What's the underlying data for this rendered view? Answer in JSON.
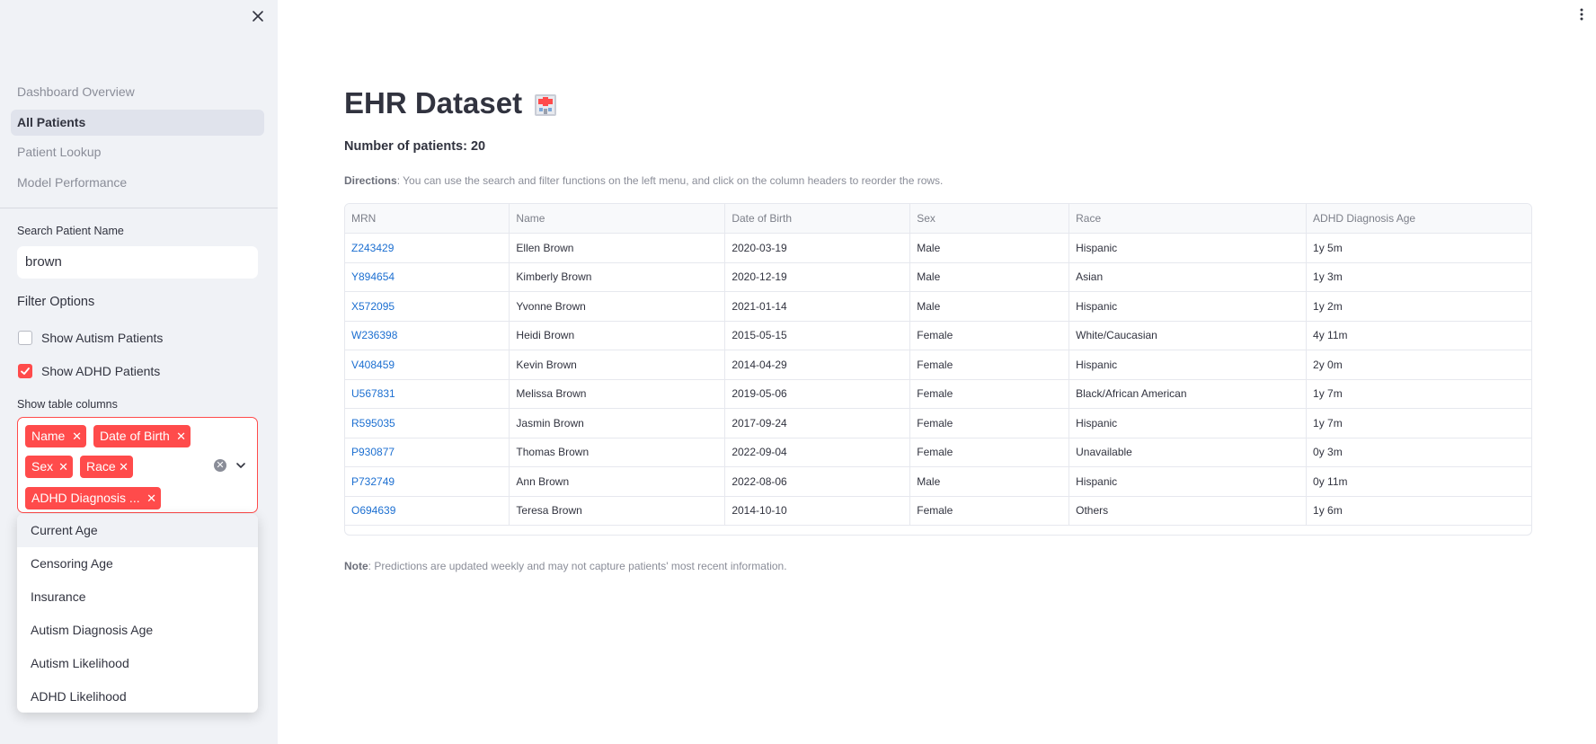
{
  "sidebar": {
    "nav": [
      {
        "label": "Dashboard Overview",
        "active": false
      },
      {
        "label": "All Patients",
        "active": true
      },
      {
        "label": "Patient Lookup",
        "active": false
      },
      {
        "label": "Model Performance",
        "active": false
      }
    ],
    "search_label": "Search Patient Name",
    "search_value": "brown",
    "filter_title": "Filter Options",
    "show_autism": {
      "label": "Show Autism Patients",
      "checked": false
    },
    "show_adhd": {
      "label": "Show ADHD Patients",
      "checked": true
    },
    "columns_label": "Show table columns",
    "selected_columns": [
      "Name",
      "Date of Birth",
      "Sex",
      "Race",
      "ADHD Diagnosis ..."
    ],
    "dropdown_options": [
      "Current Age",
      "Censoring Age",
      "Insurance",
      "Autism Diagnosis Age",
      "Autism Likelihood",
      "ADHD Likelihood"
    ]
  },
  "main": {
    "title": "EHR Dataset",
    "title_icon": "hospital-icon",
    "count_label": "Number of patients: 20",
    "directions_label": "Directions",
    "directions_text": ": You can use the search and filter functions on the left menu, and click on the column headers to reorder the rows.",
    "note_label": "Note",
    "note_text": ": Predictions are updated weekly and may not capture patients' most recent information."
  },
  "table": {
    "headers": [
      "MRN",
      "Name",
      "Date of Birth",
      "Sex",
      "Race",
      "ADHD Diagnosis Age"
    ],
    "rows": [
      [
        "Z243429",
        "Ellen Brown",
        "2020-03-19",
        "Male",
        "Hispanic",
        "1y 5m"
      ],
      [
        "Y894654",
        "Kimberly Brown",
        "2020-12-19",
        "Male",
        "Asian",
        "1y 3m"
      ],
      [
        "X572095",
        "Yvonne Brown",
        "2021-01-14",
        "Male",
        "Hispanic",
        "1y 2m"
      ],
      [
        "W236398",
        "Heidi Brown",
        "2015-05-15",
        "Female",
        "White/Caucasian",
        "4y 11m"
      ],
      [
        "V408459",
        "Kevin Brown",
        "2014-04-29",
        "Female",
        "Hispanic",
        "2y 0m"
      ],
      [
        "U567831",
        "Melissa Brown",
        "2019-05-06",
        "Female",
        "Black/African American",
        "1y 7m"
      ],
      [
        "R595035",
        "Jasmin Brown",
        "2017-09-24",
        "Female",
        "Hispanic",
        "1y 7m"
      ],
      [
        "P930877",
        "Thomas Brown",
        "2022-09-04",
        "Female",
        "Unavailable",
        "0y 3m"
      ],
      [
        "P732749",
        "Ann Brown",
        "2022-08-06",
        "Male",
        "Hispanic",
        "0y 11m"
      ],
      [
        "O694639",
        "Teresa Brown",
        "2014-10-10",
        "Female",
        "Others",
        "1y 6m"
      ]
    ]
  },
  "colors": {
    "accent": "#ff4b4b",
    "link": "#1c6fd1",
    "sidebar_bg": "#f0f2f6"
  }
}
